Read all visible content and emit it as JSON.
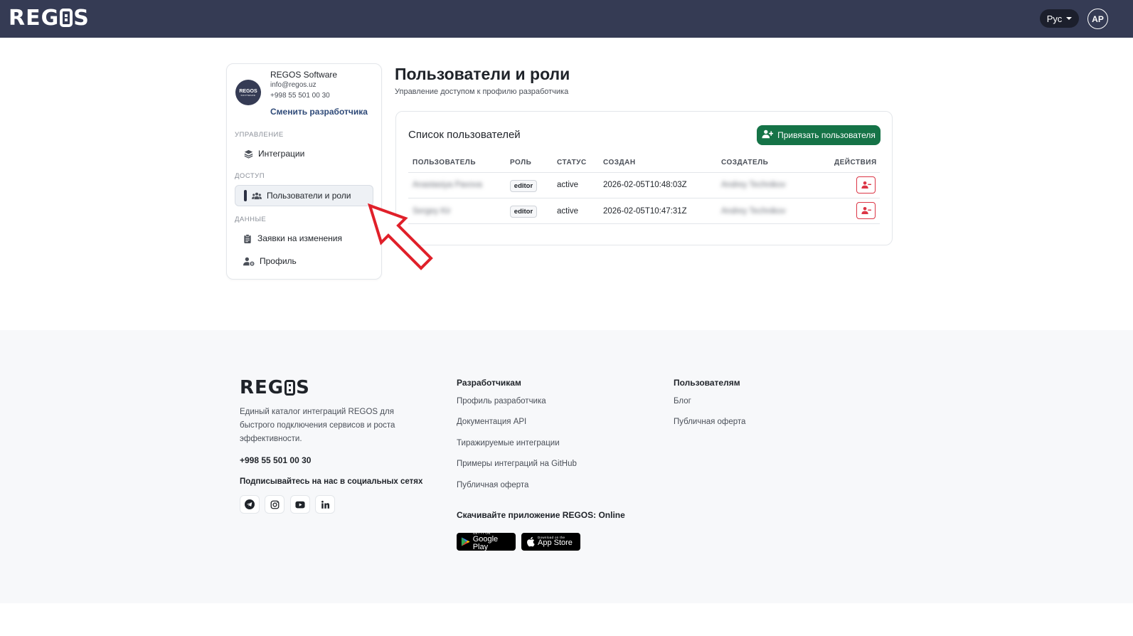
{
  "header": {
    "logo_left": "REG",
    "logo_right": "S",
    "lang": "Рус",
    "avatar": "AP"
  },
  "sidebar": {
    "dev_logo_text": "REGOS",
    "dev_logo_sub": "SOFTWARE",
    "dev_name": "REGOS Software",
    "dev_email": "info@regos.uz",
    "dev_phone": "+998 55 501 00 30",
    "switch_label": "Сменить разработчика",
    "sections": {
      "manage": "УПРАВЛЕНИЕ",
      "access": "ДОСТУП",
      "data": "ДАННЫЕ"
    },
    "items": {
      "integrations": "Интеграции",
      "users": "Пользователи и роли",
      "requests": "Заявки на изменения",
      "profile": "Профиль"
    }
  },
  "main": {
    "title": "Пользователи и роли",
    "subtitle": "Управление доступом к профилю разработчика",
    "card_title": "Список пользователей",
    "bind_button": "Привязать пользователя",
    "columns": {
      "user": "ПОЛЬЗОВАТЕЛЬ",
      "role": "РОЛЬ",
      "status": "СТАТУС",
      "created": "СОЗДАН",
      "creator": "СОЗДАТЕЛЬ",
      "actions": "ДЕЙСТВИЯ"
    },
    "rows": [
      {
        "user": "Anastasiya Pavova",
        "role": "editor",
        "status": "active",
        "created": "2026-02-05T10:48:03Z",
        "creator": "Andrey Technikov"
      },
      {
        "user": "Sergey Kir",
        "role": "editor",
        "status": "active",
        "created": "2026-02-05T10:47:31Z",
        "creator": "Andrey Technikov"
      }
    ]
  },
  "footer": {
    "logo_left": "REG",
    "logo_right": "S",
    "description": "Единый каталог интеграций REGOS для быстрого подключения сервисов и роста эффективности.",
    "phone": "+998 55 501 00 30",
    "social_title": "Подписывайтесь на нас в социальных сетях",
    "developers_title": "Разработчикам",
    "developers_links": [
      "Профиль разработчика",
      "Документация API",
      "Тиражируемые интеграции",
      "Примеры интеграций на GitHub",
      "Публичная оферта"
    ],
    "users_title": "Пользователям",
    "users_links": [
      "Блог",
      "Публичная оферта"
    ],
    "app_title": "Скачивайте приложение REGOS: Online",
    "google_small": "GET IT ON",
    "google_big": "Google Play",
    "apple_small": "Download on the",
    "apple_big": "App Store"
  },
  "colors": {
    "header_bg": "#353b54",
    "primary_green": "#157347",
    "danger_red": "#dc3545",
    "link_blue": "#2f4a78"
  }
}
